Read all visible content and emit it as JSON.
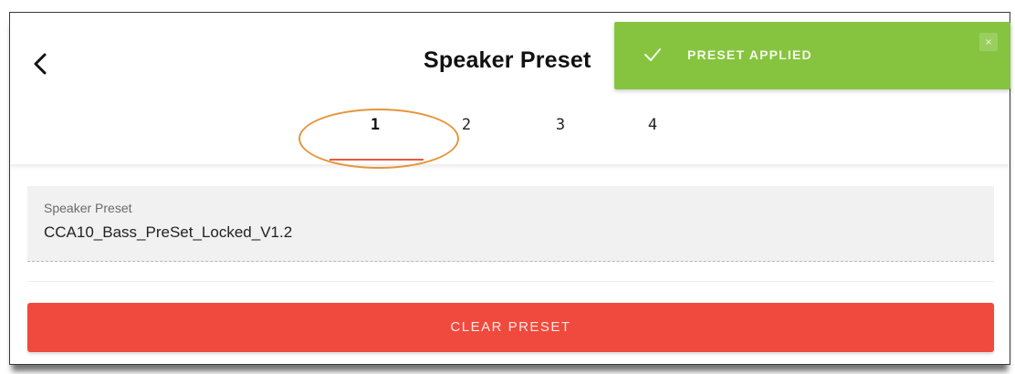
{
  "header": {
    "title": "Speaker Preset",
    "back_icon": "chevron-left-icon"
  },
  "tabs": [
    {
      "label": "1",
      "active": true
    },
    {
      "label": "2",
      "active": false
    },
    {
      "label": "3",
      "active": false
    },
    {
      "label": "4",
      "active": false
    }
  ],
  "preset_field": {
    "label": "Speaker Preset",
    "value": "CCA10_Bass_PreSet_Locked_V1.2"
  },
  "clear_button": {
    "label": "CLEAR PRESET",
    "color": "#ef4a3d"
  },
  "toast": {
    "message": "PRESET APPLIED",
    "icon": "check-icon",
    "close_label": "×",
    "color": "#86c440"
  },
  "colors": {
    "accent_underline": "#e8583f",
    "highlight_ellipse": "#e5963a"
  }
}
